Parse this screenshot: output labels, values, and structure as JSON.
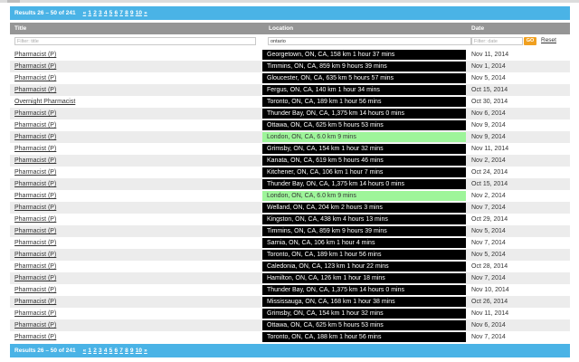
{
  "pager": {
    "results_text": "Results 26 – 50 of 241",
    "links": [
      "«",
      "1",
      "2",
      "3",
      "4",
      "5",
      "6",
      "7",
      "8",
      "9",
      "10",
      "»"
    ]
  },
  "table": {
    "columns": {
      "title": "Title",
      "location": "Location",
      "date": "Date"
    },
    "filters": {
      "title_placeholder": "Filter: title",
      "location_value": "ontario",
      "date_placeholder": "Filter: date",
      "go_label": "GO",
      "reset_label": "Reset"
    },
    "rows": [
      {
        "title": "Pharmacist (P)",
        "location": "Georgetown, ON, CA, 158 km 1 hour 37 mins",
        "date": "Nov 11, 2014",
        "highlight": false
      },
      {
        "title": "Pharmacist (P)",
        "location": "Timmins, ON, CA, 859 km 9 hours 39 mins",
        "date": "Nov 1, 2014",
        "highlight": false
      },
      {
        "title": "Pharmacist (P)",
        "location": "Gloucester, ON, CA, 635 km 5 hours 57 mins",
        "date": "Nov 5, 2014",
        "highlight": false
      },
      {
        "title": "Pharmacist (P)",
        "location": "Fergus, ON, CA, 140 km 1 hour 34 mins",
        "date": "Oct 15, 2014",
        "highlight": false
      },
      {
        "title": "Overnight Pharmacist",
        "location": "Toronto, ON, CA, 189 km 1 hour 56 mins",
        "date": "Oct 30, 2014",
        "highlight": false
      },
      {
        "title": "Pharmacist (P)",
        "location": "Thunder Bay, ON, CA, 1,375 km 14 hours 0 mins",
        "date": "Nov 6, 2014",
        "highlight": false
      },
      {
        "title": "Pharmacist (P)",
        "location": "Ottawa, ON, CA, 625 km 5 hours 53 mins",
        "date": "Nov 9, 2014",
        "highlight": false
      },
      {
        "title": "Pharmacist (P)",
        "location": "London, ON, CA, 6.0 km 9 mins",
        "date": "Nov 9, 2014",
        "highlight": true
      },
      {
        "title": "Pharmacist (P)",
        "location": "Grimsby, ON, CA, 154 km 1 hour 32 mins",
        "date": "Nov 11, 2014",
        "highlight": false
      },
      {
        "title": "Pharmacist (P)",
        "location": "Kanata, ON, CA, 619 km 5 hours 46 mins",
        "date": "Nov 2, 2014",
        "highlight": false
      },
      {
        "title": "Pharmacist (P)",
        "location": "Kitchener, ON, CA, 106 km 1 hour 7 mins",
        "date": "Oct 24, 2014",
        "highlight": false
      },
      {
        "title": "Pharmacist (P)",
        "location": "Thunder Bay, ON, CA, 1,375 km 14 hours 0 mins",
        "date": "Oct 15, 2014",
        "highlight": false
      },
      {
        "title": "Pharmacist (P)",
        "location": "London, ON, CA, 6.0 km 9 mins",
        "date": "Nov 2, 2014",
        "highlight": true
      },
      {
        "title": "Pharmacist (P)",
        "location": "Welland, ON, CA, 204 km 2 hours 3 mins",
        "date": "Nov 7, 2014",
        "highlight": false
      },
      {
        "title": "Pharmacist (P)",
        "location": "Kingston, ON, CA, 438 km 4 hours 13 mins",
        "date": "Oct 29, 2014",
        "highlight": false
      },
      {
        "title": "Pharmacist (P)",
        "location": "Timmins, ON, CA, 859 km 9 hours 39 mins",
        "date": "Nov 5, 2014",
        "highlight": false
      },
      {
        "title": "Pharmacist (P)",
        "location": "Sarnia, ON, CA, 106 km 1 hour 4 mins",
        "date": "Nov 7, 2014",
        "highlight": false
      },
      {
        "title": "Pharmacist (P)",
        "location": "Toronto, ON, CA, 189 km 1 hour 56 mins",
        "date": "Nov 5, 2014",
        "highlight": false
      },
      {
        "title": "Pharmacist (P)",
        "location": "Caledonia, ON, CA, 123 km 1 hour 22 mins",
        "date": "Oct 28, 2014",
        "highlight": false
      },
      {
        "title": "Pharmacist (P)",
        "location": "Hamilton, ON, CA, 126 km 1 hour 18 mins",
        "date": "Nov 7, 2014",
        "highlight": false
      },
      {
        "title": "Pharmacist (P)",
        "location": "Thunder Bay, ON, CA, 1,375 km 14 hours 0 mins",
        "date": "Nov 10, 2014",
        "highlight": false
      },
      {
        "title": "Pharmacist (P)",
        "location": "Mississauga, ON, CA, 168 km 1 hour 38 mins",
        "date": "Oct 26, 2014",
        "highlight": false
      },
      {
        "title": "Pharmacist (P)",
        "location": "Grimsby, ON, CA, 154 km 1 hour 32 mins",
        "date": "Nov 11, 2014",
        "highlight": false
      },
      {
        "title": "Pharmacist (P)",
        "location": "Ottawa, ON, CA, 625 km 5 hours 53 mins",
        "date": "Nov 6, 2014",
        "highlight": false
      },
      {
        "title": "Pharmacist (P)",
        "location": "Toronto, ON, CA, 188 km 1 hour 56 mins",
        "date": "Nov 7, 2014",
        "highlight": false
      }
    ]
  },
  "colors": {
    "pager_bg": "#4ab3e6",
    "header_bg": "#959595",
    "location_bg": "#000000",
    "location_near_bg": "#9ef59a",
    "go_button": "#f0a020"
  }
}
